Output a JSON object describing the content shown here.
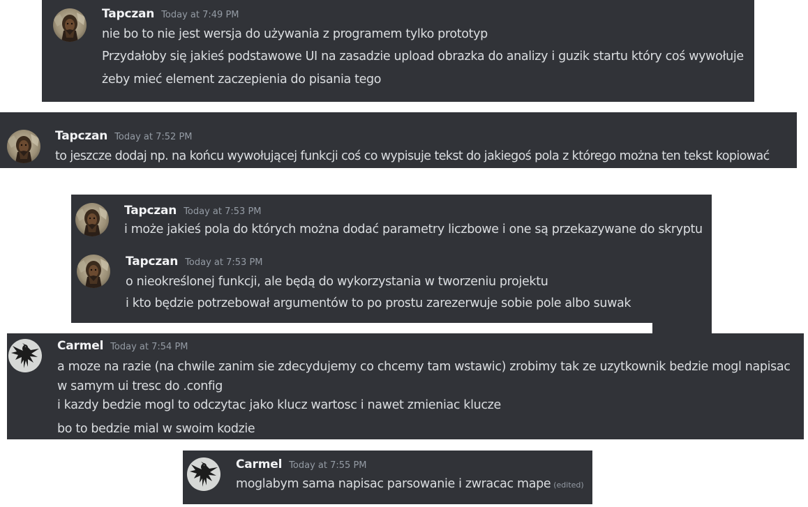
{
  "messages": [
    {
      "username": "Tapczan",
      "timestamp": "Today at 7:49 PM",
      "avatar_icon": "tapczan-avatar-icon",
      "lines": [
        "nie bo to nie jest wersja do używania z programem tylko prototyp",
        "Przydałoby się jakieś podstawowe UI na zasadzie upload obrazka do analizy i guzik startu który coś wywołuje",
        "żeby mieć element zaczepienia do pisania tego"
      ]
    },
    {
      "username": "Tapczan",
      "timestamp": "Today at 7:52 PM",
      "avatar_icon": "tapczan-avatar-icon",
      "lines": [
        "to jeszcze dodaj np. na końcu wywołującej funkcji coś co wypisuje tekst do jakiegoś pola z którego można ten tekst kopiować"
      ]
    },
    {
      "username": "Tapczan",
      "timestamp": "Today at 7:53 PM",
      "avatar_icon": "tapczan-avatar-icon",
      "lines": [
        "i może jakieś pola do których można dodać parametry liczbowe i one są przekazywane do skryptu"
      ]
    },
    {
      "username": "Tapczan",
      "timestamp": "Today at 7:53 PM",
      "avatar_icon": "tapczan-avatar-icon",
      "lines": [
        "o nieokreślonej funkcji, ale będą do wykorzystania w tworzeniu projektu",
        "i kto będzie potrzebował argumentów to po prostu zarezerwuje sobie pole albo suwak"
      ]
    },
    {
      "username": "Carmel",
      "timestamp": "Today at 7:54 PM",
      "avatar_icon": "carmel-crow-avatar-icon",
      "lines": [
        "a moze na razie (na chwile zanim sie zdecydujemy co chcemy tam wstawic) zrobimy tak ze uzytkownik bedzie mogl napisac w samym ui tresc do .config",
        "i kazdy bedzie mogl to odczytac jako klucz wartosc i nawet zmieniac klucze",
        "bo to bedzie mial w swoim kodzie"
      ]
    },
    {
      "username": "Carmel",
      "timestamp": "Today at 7:55 PM",
      "avatar_icon": "carmel-crow-avatar-icon",
      "lines": [
        "moglabym sama napisac parsowanie i zwracac mape"
      ],
      "edited_label": "(edited)"
    }
  ],
  "colors": {
    "background": "#313338",
    "username": "#f2f3f5",
    "text": "#dbdee1",
    "muted": "#949ba4"
  }
}
